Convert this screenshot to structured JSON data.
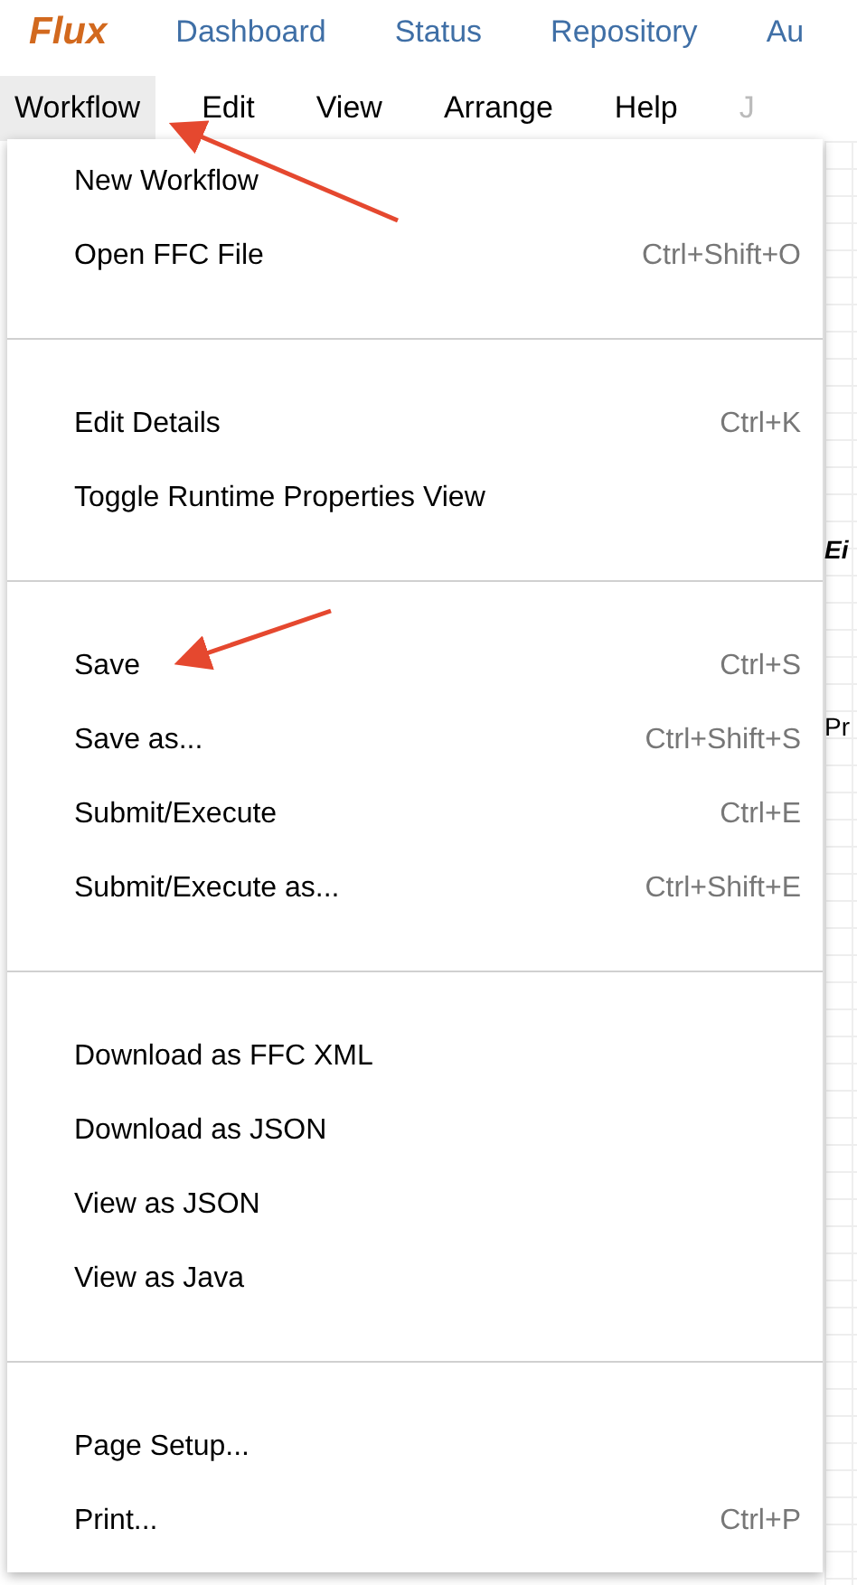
{
  "header": {
    "logo": "Flux",
    "links": [
      "Dashboard",
      "Status",
      "Repository",
      "Au"
    ]
  },
  "menubar": [
    {
      "label": "Workflow",
      "selected": true
    },
    {
      "label": "Edit",
      "selected": false
    },
    {
      "label": "View",
      "selected": false
    },
    {
      "label": "Arrange",
      "selected": false
    },
    {
      "label": "Help",
      "selected": false
    },
    {
      "label": "J",
      "selected": false
    }
  ],
  "canvas_fragments": [
    {
      "text": "Ei",
      "kind": "title"
    },
    {
      "text": "Pr",
      "kind": "label"
    }
  ],
  "menu": {
    "sections": [
      [
        {
          "label": "New Workflow"
        },
        {
          "label": "Open FFC File",
          "shortcut": "Ctrl+Shift+O"
        }
      ],
      [
        {
          "label": "Edit Details",
          "shortcut": "Ctrl+K"
        },
        {
          "label": "Toggle Runtime Properties View"
        }
      ],
      [
        {
          "label": "Save",
          "shortcut": "Ctrl+S"
        },
        {
          "label": "Save as...",
          "shortcut": "Ctrl+Shift+S"
        },
        {
          "label": "Submit/Execute",
          "shortcut": "Ctrl+E"
        },
        {
          "label": "Submit/Execute as...",
          "shortcut": "Ctrl+Shift+E"
        }
      ],
      [
        {
          "label": "Download as FFC XML"
        },
        {
          "label": "Download as JSON"
        },
        {
          "label": "View as JSON"
        },
        {
          "label": "View as Java"
        }
      ],
      [
        {
          "label": "Page Setup..."
        },
        {
          "label": "Print...",
          "shortcut": "Ctrl+P"
        }
      ]
    ]
  }
}
